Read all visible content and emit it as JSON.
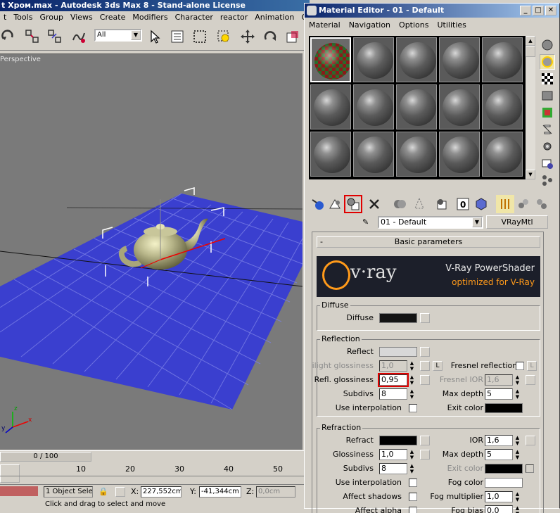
{
  "max": {
    "title": "t Хром.max - Autodesk 3ds Max 8  - Stand-alone License",
    "menu": [
      "t",
      "Tools",
      "Group",
      "Views",
      "Create",
      "Modifiers",
      "Character",
      "reactor",
      "Animation",
      "Graph"
    ],
    "selection_filter": "All",
    "viewport_label": "Perspective",
    "time_slider": "0 / 100",
    "ruler_ticks": [
      "10",
      "20",
      "30",
      "40",
      "50"
    ],
    "status_selected": "1 Object Sele",
    "x_label": "X:",
    "x_value": "227,552cm",
    "y_label": "Y:",
    "y_value": "-41,344cm",
    "z_label": "Z:",
    "z_value": "0,0cm",
    "prompt": "Click and drag to select and move"
  },
  "me": {
    "title": "Material Editor - 01 - Default",
    "menu": [
      "Material",
      "Navigation",
      "Options",
      "Utilities"
    ],
    "material_name": "01 - Default",
    "material_type": "VRayMtl",
    "rollout_title": "Basic parameters",
    "vray_line1": "V-Ray PowerShader",
    "vray_line2": "optimized for V-Ray",
    "vray_logo": "v·ray",
    "diffuse": {
      "group": "Diffuse",
      "label": "Diffuse"
    },
    "reflection": {
      "group": "Reflection",
      "reflect": "Reflect",
      "hilight_gloss": "Hilight glossiness",
      "hilight_val": "1,0",
      "l_btn": "L",
      "fresnel": "Fresnel reflections",
      "refl_gloss": "Refl. glossiness",
      "refl_gloss_val": "0,95",
      "fresnel_ior": "Fresnel IOR",
      "fresnel_ior_val": "1,6",
      "subdivs": "Subdivs",
      "subdivs_val": "8",
      "max_depth": "Max depth",
      "max_depth_val": "5",
      "use_interp": "Use interpolation",
      "exit_color": "Exit color"
    },
    "refraction": {
      "group": "Refraction",
      "refract": "Refract",
      "ior": "IOR",
      "ior_val": "1,6",
      "glossiness": "Glossiness",
      "gloss_val": "1,0",
      "max_depth": "Max depth",
      "max_depth_val": "5",
      "subdivs": "Subdivs",
      "subdivs_val": "8",
      "exit_color": "Exit color",
      "use_interp": "Use interpolation",
      "fog_color": "Fog color",
      "affect_shadows": "Affect shadows",
      "fog_mult": "Fog multiplier",
      "fog_mult_val": "1,0",
      "affect_alpha": "Affect alpha",
      "fog_bias": "Fog bias",
      "fog_bias_val": "0,0"
    }
  }
}
